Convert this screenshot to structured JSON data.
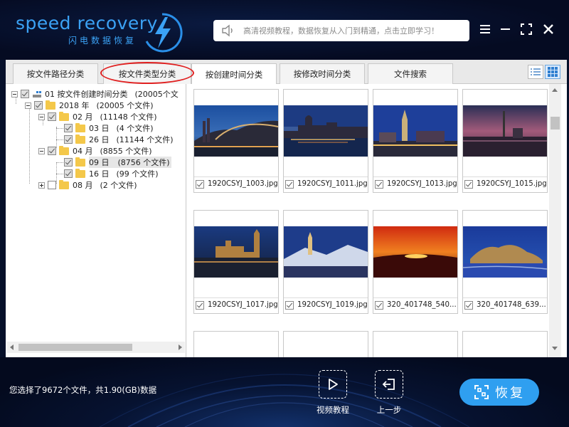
{
  "header": {
    "logo_text": "speed recovery",
    "logo_sub": "闪电数据恢复",
    "search_placeholder": "高清视频教程，数据恢复从入门到精通，点击立即学习！"
  },
  "tabs": [
    {
      "label": "按文件路径分类"
    },
    {
      "label": "按文件类型分类"
    },
    {
      "label": "按创建时间分类"
    },
    {
      "label": "按修改时间分类"
    },
    {
      "label": "文件搜索"
    }
  ],
  "tree": {
    "root": {
      "label": "01 按文件创建时间分类",
      "count": "(20005个文"
    },
    "nodes": [
      {
        "label": "2018 年",
        "count": "(20005 个文件)"
      },
      {
        "label": "02 月",
        "count": "(11148 个文件)"
      },
      {
        "label": "03 日",
        "count": "(4 个文件)"
      },
      {
        "label": "26 日",
        "count": "(11144 个文件)"
      },
      {
        "label": "04 月",
        "count": "(8855 个文件)"
      },
      {
        "label": "09 日",
        "count": "(8756 个文件)"
      },
      {
        "label": "16 日",
        "count": "(99 个文件)"
      },
      {
        "label": "08 月",
        "count": "(2 个文件)"
      }
    ]
  },
  "files": [
    {
      "name": "1920CSYJ_1003.jpg",
      "checked": true
    },
    {
      "name": "1920CSYJ_1011.jpg",
      "checked": true
    },
    {
      "name": "1920CSYJ_1013.jpg",
      "checked": true
    },
    {
      "name": "1920CSYJ_1015.jpg",
      "checked": true
    },
    {
      "name": "1920CSYJ_1017.jpg",
      "checked": true
    },
    {
      "name": "1920CSYJ_1019.jpg",
      "checked": true
    },
    {
      "name": "320_401748_540...",
      "checked": true
    },
    {
      "name": "320_401748_639...",
      "checked": true
    }
  ],
  "footer": {
    "status": "您选择了9672个文件，共1.90(GB)数据",
    "video_label": "视频教程",
    "back_label": "上一步",
    "recover_label": "恢复"
  },
  "colors": {
    "accent": "#2f9ff0",
    "brand_blue": "#3ba2f5",
    "header_bg": "#06102a",
    "highlight_circle": "#e02020"
  }
}
